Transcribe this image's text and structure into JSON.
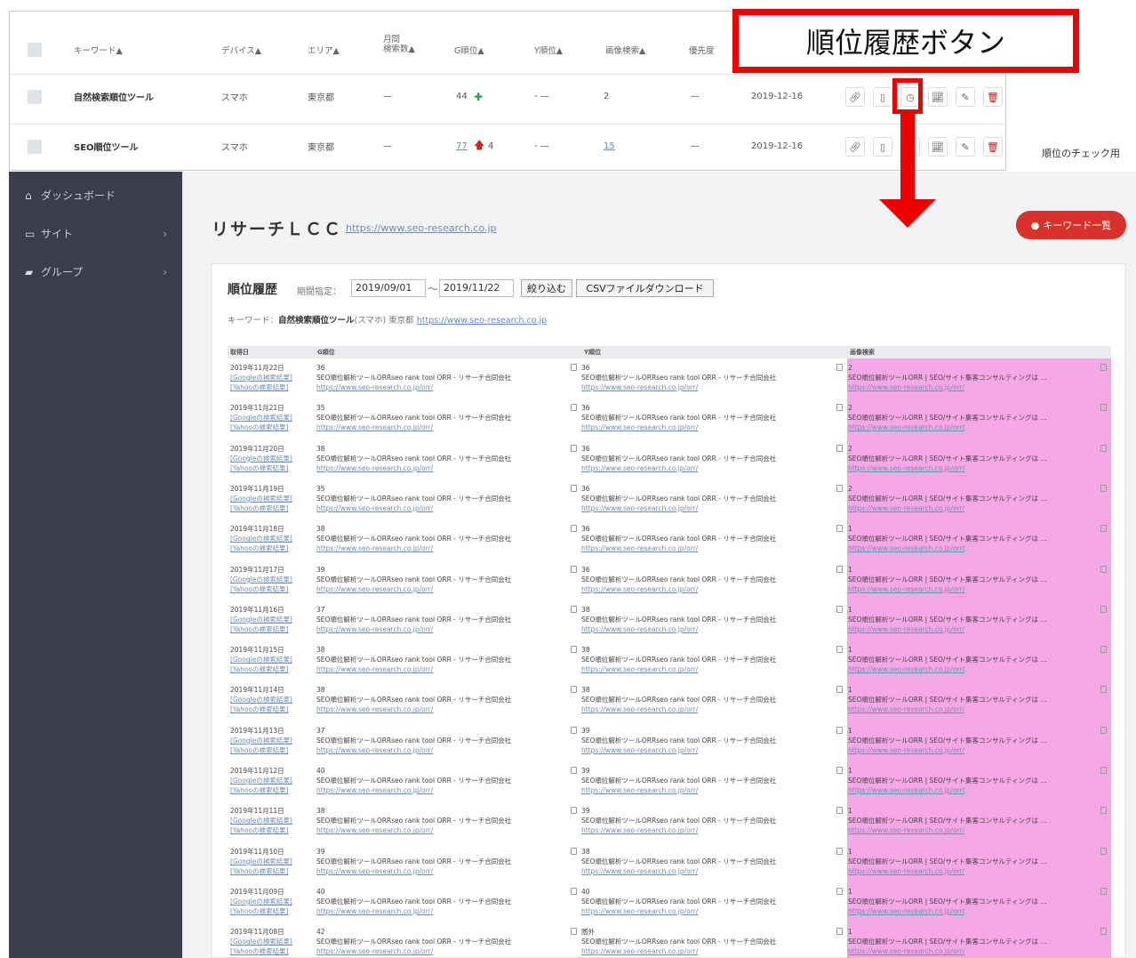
{
  "callout": {
    "label": "順位履歴ボタン"
  },
  "top_table": {
    "headers": [
      "キーワード▲",
      "デバイス▲",
      "エリア▲",
      "月間\n検索数▲",
      "G順位▲",
      "Y順位▲",
      "画像検索▲",
      "優先度"
    ],
    "header_monthly_line1": "月間",
    "header_monthly_line2": "検索数▲",
    "rows": [
      {
        "keyword": "自然検索順位ツール",
        "device": "スマホ",
        "area": "東京都",
        "monthly": "—",
        "g_rank": "44",
        "g_change": "",
        "y_rank": "- —",
        "image": "2",
        "priority": "—",
        "date": "2019-12-16"
      },
      {
        "keyword": "SEO順位ツール",
        "device": "スマホ",
        "area": "東京都",
        "monthly": "—",
        "g_rank": "77",
        "g_change": "4",
        "y_rank": "- —",
        "image": "15",
        "priority": "—",
        "date": "2019-12-16"
      }
    ],
    "right_label": "順位のチェック用"
  },
  "sidebar": {
    "items": [
      {
        "label": "ダッシュボード",
        "icon": "home-icon"
      },
      {
        "label": "サイト",
        "icon": "monitor-icon"
      },
      {
        "label": "グループ",
        "icon": "folder-icon"
      }
    ]
  },
  "site": {
    "name": "リサーチＬＣＣ",
    "url": "https://www.seo-research.co.jp"
  },
  "kw_list_button": "キーワード一覧",
  "history": {
    "title": "順位履歴",
    "period_label": "期間指定：",
    "date_from": "2019/09/01",
    "tilde": "～",
    "date_to": "2019/11/22",
    "filter_button": "絞り込む",
    "csv_button": "CSVファイルダウンロード",
    "kw_prefix": "キーワード：",
    "kw_bold": "自然検索順位ツール",
    "kw_suffix": "(スマホ) 東京都",
    "kw_url": "https://www.seo-research.co.jp",
    "columns": [
      "取得日",
      "G順位",
      "Y順位",
      "画像検索"
    ],
    "google_link": "[Googleの検索結果]",
    "yahoo_link": "[Yahooの検索結果]",
    "result_title": "SEO順位解析ツールORRseo rank tool ORR - リサーチ合同会社",
    "result_url": "https://www.seo-research.co.jp/orr/",
    "image_title": "SEO順位解析ツールORR | SEO/サイト集客コンサルティングは …",
    "rows": [
      {
        "date": "2019年11月22日",
        "g": "36",
        "y": "36",
        "img": "2"
      },
      {
        "date": "2019年11月21日",
        "g": "35",
        "y": "36",
        "img": "2"
      },
      {
        "date": "2019年11月20日",
        "g": "38",
        "y": "36",
        "img": "2"
      },
      {
        "date": "2019年11月19日",
        "g": "35",
        "y": "36",
        "img": "2"
      },
      {
        "date": "2019年11月18日",
        "g": "38",
        "y": "36",
        "img": "1"
      },
      {
        "date": "2019年11月17日",
        "g": "39",
        "y": "36",
        "img": "1"
      },
      {
        "date": "2019年11月16日",
        "g": "37",
        "y": "38",
        "img": "1"
      },
      {
        "date": "2019年11月15日",
        "g": "38",
        "y": "38",
        "img": "1"
      },
      {
        "date": "2019年11月14日",
        "g": "38",
        "y": "38",
        "img": "1"
      },
      {
        "date": "2019年11月13日",
        "g": "37",
        "y": "39",
        "img": "1"
      },
      {
        "date": "2019年11月12日",
        "g": "40",
        "y": "39",
        "img": "1"
      },
      {
        "date": "2019年11月11日",
        "g": "38",
        "y": "39",
        "img": "1"
      },
      {
        "date": "2019年11月10日",
        "g": "39",
        "y": "38",
        "img": "1"
      },
      {
        "date": "2019年11月09日",
        "g": "40",
        "y": "40",
        "img": "1"
      },
      {
        "date": "2019年11月08日",
        "g": "42",
        "y": "圏外",
        "img": "1"
      }
    ]
  },
  "colors": {
    "sidebar_bg": "#3a3d4d",
    "accent_red": "#d8322b",
    "highlight_red": "#ee0000",
    "image_col_bg": "#f6a8e6",
    "rank_up_green": "#2a9d4a",
    "rank_up_red": "#d82020"
  }
}
